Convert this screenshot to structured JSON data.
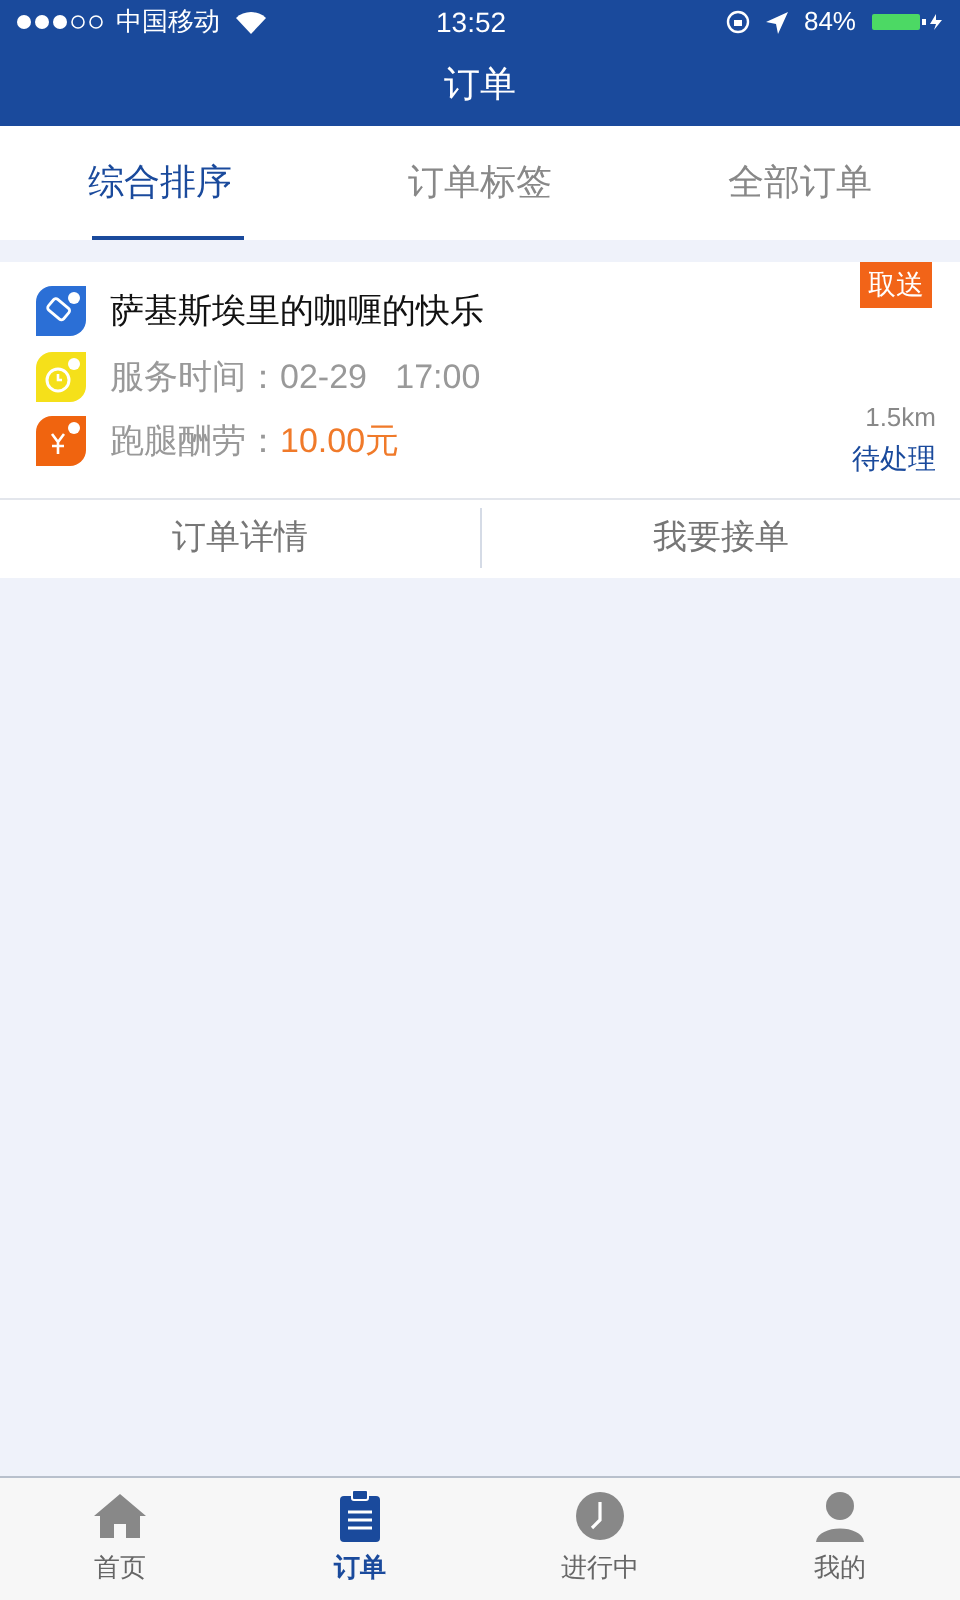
{
  "status_bar": {
    "carrier": "中国移动",
    "time": "13:52",
    "battery": "84%"
  },
  "nav": {
    "title": "订单"
  },
  "tabs": [
    {
      "label": "综合排序",
      "selected": true
    },
    {
      "label": "订单标签",
      "selected": false
    },
    {
      "label": "全部订单",
      "selected": false
    }
  ],
  "orders": [
    {
      "title": "萨基斯埃里的咖喱的快乐",
      "tag": "取送",
      "service_time_label": "服务时间：",
      "service_time": "02-29   17:00",
      "fee_label": "跑腿酬劳：",
      "fee": "10.00元",
      "distance": "1.5km",
      "status": "待处理",
      "actions": [
        "订单详情",
        "我要接单"
      ]
    }
  ],
  "tab_bar": [
    {
      "label": "首页",
      "kind": "home",
      "selected": false
    },
    {
      "label": "订单",
      "kind": "clipboard",
      "selected": true
    },
    {
      "label": "进行中",
      "kind": "clock",
      "selected": false
    },
    {
      "label": "我的",
      "kind": "person",
      "selected": false
    }
  ]
}
